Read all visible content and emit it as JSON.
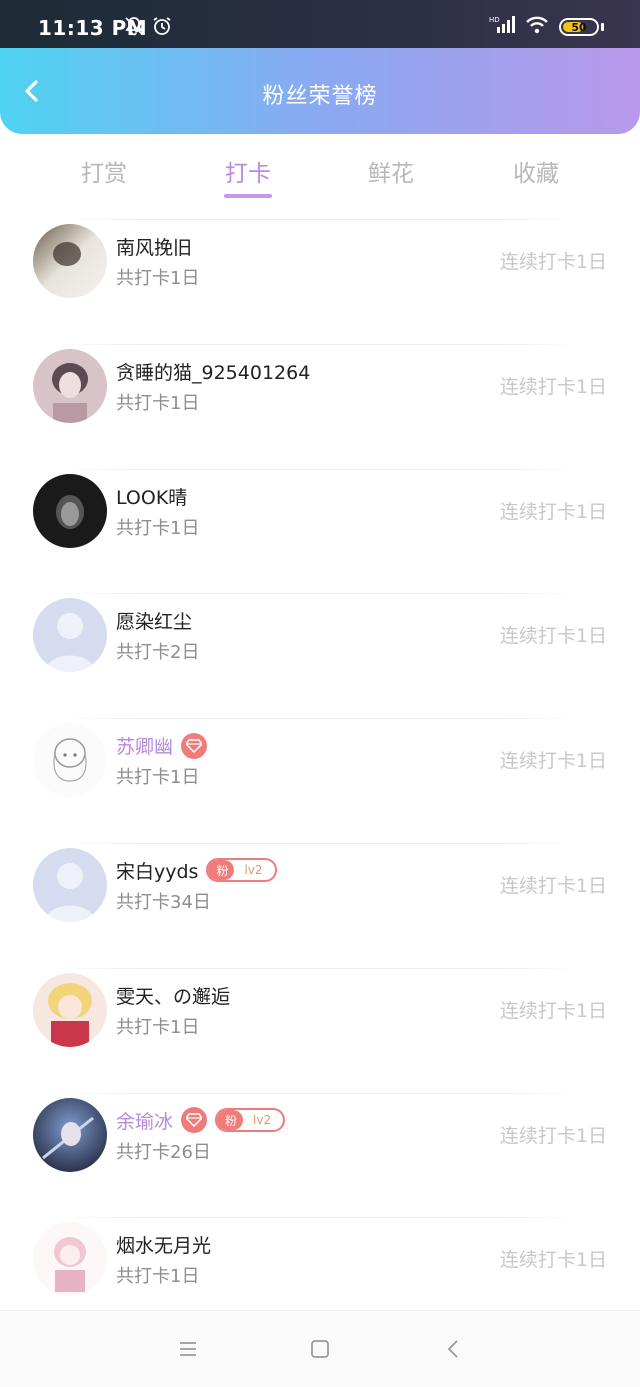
{
  "status": {
    "time": "11:13 PM",
    "battery": "50",
    "network_label": "HD",
    "icons": [
      "bell-off-icon",
      "alarm-icon",
      "signal-icon",
      "wifi-icon",
      "battery-icon"
    ]
  },
  "header": {
    "title": "粉丝荣誉榜",
    "back_icon": "chevron-left-icon"
  },
  "tabs": [
    {
      "label": "打赏",
      "active": false
    },
    {
      "label": "打卡",
      "active": true
    },
    {
      "label": "鲜花",
      "active": false
    },
    {
      "label": "收藏",
      "active": false
    }
  ],
  "rows": [
    {
      "name": "南风挽旧",
      "total": "共打卡1日",
      "streak": "连续打卡1日",
      "vip": false,
      "gem": false,
      "fan_badge": null
    },
    {
      "name": "贪睡的猫_925401264",
      "total": "共打卡1日",
      "streak": "连续打卡1日",
      "vip": false,
      "gem": false,
      "fan_badge": null
    },
    {
      "name": "LOOK晴",
      "total": "共打卡1日",
      "streak": "连续打卡1日",
      "vip": false,
      "gem": false,
      "fan_badge": null
    },
    {
      "name": "愿染红尘",
      "total": "共打卡2日",
      "streak": "连续打卡1日",
      "vip": false,
      "gem": false,
      "fan_badge": null
    },
    {
      "name": "苏卿幽",
      "total": "共打卡1日",
      "streak": "连续打卡1日",
      "vip": true,
      "gem": true,
      "fan_badge": null
    },
    {
      "name": "宋白yyds",
      "total": "共打卡34日",
      "streak": "连续打卡1日",
      "vip": false,
      "gem": false,
      "fan_badge": {
        "label": "粉",
        "level": "lv2"
      }
    },
    {
      "name": "雯天、の邂逅",
      "total": "共打卡1日",
      "streak": "连续打卡1日",
      "vip": false,
      "gem": false,
      "fan_badge": null
    },
    {
      "name": "余瑜冰",
      "total": "共打卡26日",
      "streak": "连续打卡1日",
      "vip": true,
      "gem": true,
      "fan_badge": {
        "label": "粉",
        "level": "lv2"
      }
    },
    {
      "name": "烟水无月光",
      "total": "共打卡1日",
      "streak": "连续打卡1日",
      "vip": false,
      "gem": false,
      "fan_badge": null
    }
  ],
  "colors": {
    "accent": "#b88be0",
    "badge": "#f07b7b",
    "header_start": "#4fd3f2",
    "header_end": "#b898ea"
  },
  "navbar": {
    "icons": [
      "menu-icon",
      "home-square-icon",
      "back-triangle-icon"
    ]
  }
}
